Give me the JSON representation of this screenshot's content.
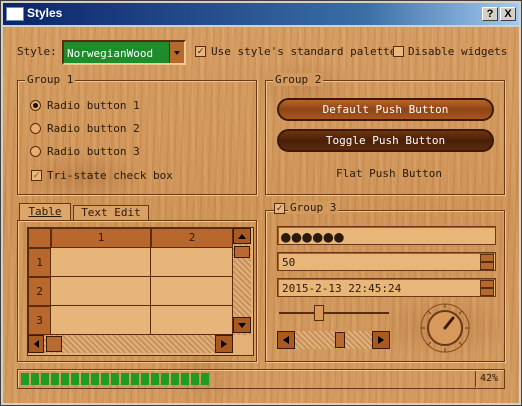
{
  "window": {
    "title": "Styles",
    "help_btn": "?",
    "close_btn": "X"
  },
  "toolbar": {
    "style_label": "Style:",
    "style_value": "NorwegianWood",
    "use_palette_label": "Use style's standard palette",
    "use_palette_checked": true,
    "disable_widgets_label": "Disable widgets",
    "disable_widgets_checked": false
  },
  "group1": {
    "title": "Group 1",
    "radio1": "Radio button 1",
    "radio2": "Radio button 2",
    "radio3": "Radio button 3",
    "tristate": "Tri-state check box"
  },
  "group2": {
    "title": "Group 2",
    "default_btn": "Default Push Button",
    "toggle_btn": "Toggle Push Button",
    "flat_btn": "Flat Push Button"
  },
  "tabs": {
    "table": "Table",
    "text_edit": "Text Edit"
  },
  "table": {
    "col1": "1",
    "col2": "2",
    "row1": "1",
    "row2": "2",
    "row3": "3"
  },
  "group3": {
    "title": "Group 3",
    "checked": true,
    "password": "●●●●●●",
    "spin_value": "50",
    "datetime": "2015-2-13 22:45:24",
    "slider_level": 0.35,
    "scroll_level": 0.6
  },
  "progress": {
    "percent_label": "42%",
    "value": 0.42
  }
}
